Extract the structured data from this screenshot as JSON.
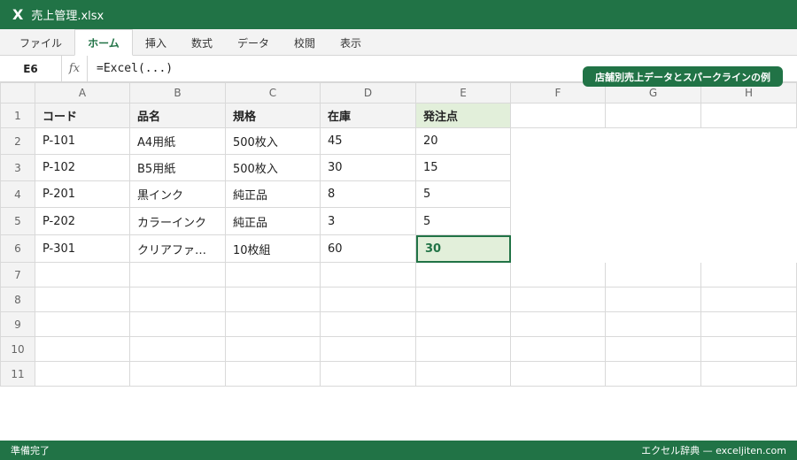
{
  "window": {
    "app_icon": "X",
    "title": "売上管理.xlsx"
  },
  "ribbon": {
    "tabs": [
      "ファイル",
      "ホーム",
      "挿入",
      "数式",
      "データ",
      "校閲",
      "表示"
    ],
    "active_tab": "ホーム"
  },
  "formula_bar": {
    "cell_ref": "E6",
    "fx": "fx",
    "formula": "=Excel(...)"
  },
  "caption": "店舗別売上データとスパークラインの例",
  "sheet": {
    "columns": [
      "A",
      "B",
      "C",
      "D",
      "E",
      "F",
      "G",
      "H"
    ],
    "row_numbers": [
      "1",
      "2",
      "3",
      "4",
      "5",
      "6",
      "7",
      "8",
      "9",
      "10",
      "11"
    ],
    "rows": [
      [
        "コード",
        "品名",
        "規格",
        "在庫",
        "発注点"
      ],
      [
        "P-101",
        "A4用紙",
        "500枚入",
        "45",
        "20"
      ],
      [
        "P-102",
        "B5用紙",
        "500枚入",
        "30",
        "15"
      ],
      [
        "P-201",
        "黒インク",
        "純正品",
        "8",
        "5"
      ],
      [
        "P-202",
        "カラーインク",
        "純正品",
        "3",
        "5"
      ],
      [
        "P-301",
        "クリアファ…",
        "10枚組",
        "60",
        "30"
      ]
    ],
    "selected_cell": "E6"
  },
  "status": {
    "left": "準備完了",
    "right": "エクセル辞典 — exceljiten.com"
  },
  "colors": {
    "accent": "#217346",
    "highlight": "#e2efda",
    "header_bg": "#f3f3f3",
    "grid_line": "#d9d9d9"
  }
}
